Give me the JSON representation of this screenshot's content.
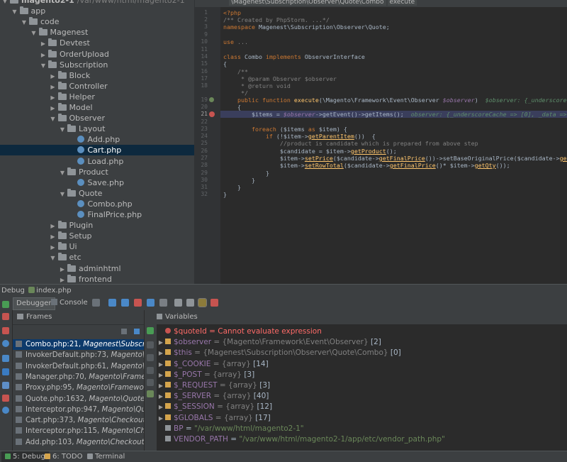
{
  "tree": {
    "items": [
      {
        "label": "magento2-1",
        "suffix": "/var/www/html/magento2-1",
        "depth": 0,
        "type": "folder",
        "open": true
      },
      {
        "label": "app",
        "depth": 1,
        "type": "folder",
        "open": true
      },
      {
        "label": "code",
        "depth": 2,
        "type": "folder",
        "open": true
      },
      {
        "label": "Magenest",
        "depth": 3,
        "type": "folder",
        "open": true
      },
      {
        "label": "Devtest",
        "depth": 4,
        "type": "folder",
        "open": false
      },
      {
        "label": "OrderUpload",
        "depth": 4,
        "type": "folder",
        "open": false
      },
      {
        "label": "Subscription",
        "depth": 4,
        "type": "folder",
        "open": true
      },
      {
        "label": "Block",
        "depth": 5,
        "type": "folder",
        "open": false
      },
      {
        "label": "Controller",
        "depth": 5,
        "type": "folder",
        "open": false
      },
      {
        "label": "Helper",
        "depth": 5,
        "type": "folder",
        "open": false
      },
      {
        "label": "Model",
        "depth": 5,
        "type": "folder",
        "open": false
      },
      {
        "label": "Observer",
        "depth": 5,
        "type": "folder",
        "open": true
      },
      {
        "label": "Layout",
        "depth": 6,
        "type": "folder",
        "open": true
      },
      {
        "label": "Add.php",
        "depth": 7,
        "type": "file"
      },
      {
        "label": "Cart.php",
        "depth": 7,
        "type": "file",
        "selected": true
      },
      {
        "label": "Load.php",
        "depth": 7,
        "type": "file"
      },
      {
        "label": "Product",
        "depth": 6,
        "type": "folder",
        "open": true
      },
      {
        "label": "Save.php",
        "depth": 7,
        "type": "file"
      },
      {
        "label": "Quote",
        "depth": 6,
        "type": "folder",
        "open": true
      },
      {
        "label": "Combo.php",
        "depth": 7,
        "type": "file"
      },
      {
        "label": "FinalPrice.php",
        "depth": 7,
        "type": "file"
      },
      {
        "label": "Plugin",
        "depth": 5,
        "type": "folder",
        "open": false
      },
      {
        "label": "Setup",
        "depth": 5,
        "type": "folder",
        "open": false
      },
      {
        "label": "Ui",
        "depth": 5,
        "type": "folder",
        "open": false
      },
      {
        "label": "etc",
        "depth": 5,
        "type": "folder",
        "open": true
      },
      {
        "label": "adminhtml",
        "depth": 6,
        "type": "folder",
        "open": false
      },
      {
        "label": "frontend",
        "depth": 6,
        "type": "folder",
        "open": false
      }
    ]
  },
  "editor": {
    "breadcrumb": [
      "\\Magenest\\Subscription\\Observer\\Quote\\Combo",
      "execute"
    ],
    "line_numbers": [
      "1",
      "2",
      "3",
      "9",
      "10",
      "11",
      "14",
      "15",
      "16",
      "17",
      "18",
      "19",
      "20",
      "21",
      "22",
      "23",
      "24",
      "25",
      "26",
      "27",
      "28",
      "29",
      "30",
      "31",
      "32"
    ],
    "current_line": "21",
    "breakpoint_line": "21"
  },
  "debug": {
    "title": "Debug",
    "config": "index.php",
    "tabs": {
      "debugger": "Debugger",
      "console": "Console"
    },
    "frames_title": "Frames",
    "variables_title": "Variables",
    "frames": [
      {
        "loc": "Combo.php:21,",
        "cls": "Magenest\\Subscription",
        "selected": true
      },
      {
        "loc": "InvokerDefault.php:73,",
        "cls": "Magento\\Fr"
      },
      {
        "loc": "InvokerDefault.php:61,",
        "cls": "Magento\\Fr"
      },
      {
        "loc": "Manager.php:70,",
        "cls": "Magento\\Framewo"
      },
      {
        "loc": "Proxy.php:95,",
        "cls": "Magento\\Framework\\"
      },
      {
        "loc": "Quote.php:1632,",
        "cls": "Magento\\Quote\\M"
      },
      {
        "loc": "Interceptor.php:947,",
        "cls": "Magento\\Quot"
      },
      {
        "loc": "Cart.php:373,",
        "cls": "Magento\\Checkout\\M"
      },
      {
        "loc": "Interceptor.php:115,",
        "cls": "Magento\\Chec"
      },
      {
        "loc": "Add.php:103,",
        "cls": "Magento\\Checkout\\Co"
      }
    ],
    "variables": [
      {
        "name": "$quoteId",
        "sep": " = ",
        "value": "Cannot evaluate expression",
        "kind": "error",
        "expand": false
      },
      {
        "name": "$observer",
        "sep": " = ",
        "value": "{Magento\\Framework\\Event\\Observer}",
        "count": "[2]",
        "expand": true
      },
      {
        "name": "$this",
        "sep": " = ",
        "value": "{Magenest\\Subscription\\Observer\\Quote\\Combo}",
        "count": "[0]",
        "expand": true
      },
      {
        "name": "$_COOKIE",
        "sep": " = ",
        "value": "{array}",
        "count": "[14]",
        "expand": true
      },
      {
        "name": "$_POST",
        "sep": " = ",
        "value": "{array}",
        "count": "[3]",
        "expand": true
      },
      {
        "name": "$_REQUEST",
        "sep": " = ",
        "value": "{array}",
        "count": "[3]",
        "expand": true
      },
      {
        "name": "$_SERVER",
        "sep": " = ",
        "value": "{array}",
        "count": "[40]",
        "expand": true
      },
      {
        "name": "$_SESSION",
        "sep": " = ",
        "value": "{array}",
        "count": "[12]",
        "expand": true
      },
      {
        "name": "$GLOBALS",
        "sep": " = ",
        "value": "{array}",
        "count": "[17]",
        "expand": true
      },
      {
        "name": "BP",
        "sep": " = ",
        "value": "\"/var/www/html/magento2-1\"",
        "kind": "string",
        "expand": false
      },
      {
        "name": "VENDOR_PATH",
        "sep": " = ",
        "value": "\"/var/www/html/magento2-1/app/etc/vendor_path.php\"",
        "kind": "string",
        "expand": false
      }
    ]
  },
  "status_tabs": [
    {
      "label": "5: Debug",
      "active": true
    },
    {
      "label": "6: TODO",
      "active": false
    },
    {
      "label": "Terminal",
      "active": false
    }
  ],
  "colors": {
    "keyword": "#cc7832",
    "variable": "#9876aa",
    "function": "#ffc66d",
    "comment": "#808080",
    "string": "#6a8759",
    "error": "#ff6b68",
    "selection": "#0d3a6b"
  }
}
